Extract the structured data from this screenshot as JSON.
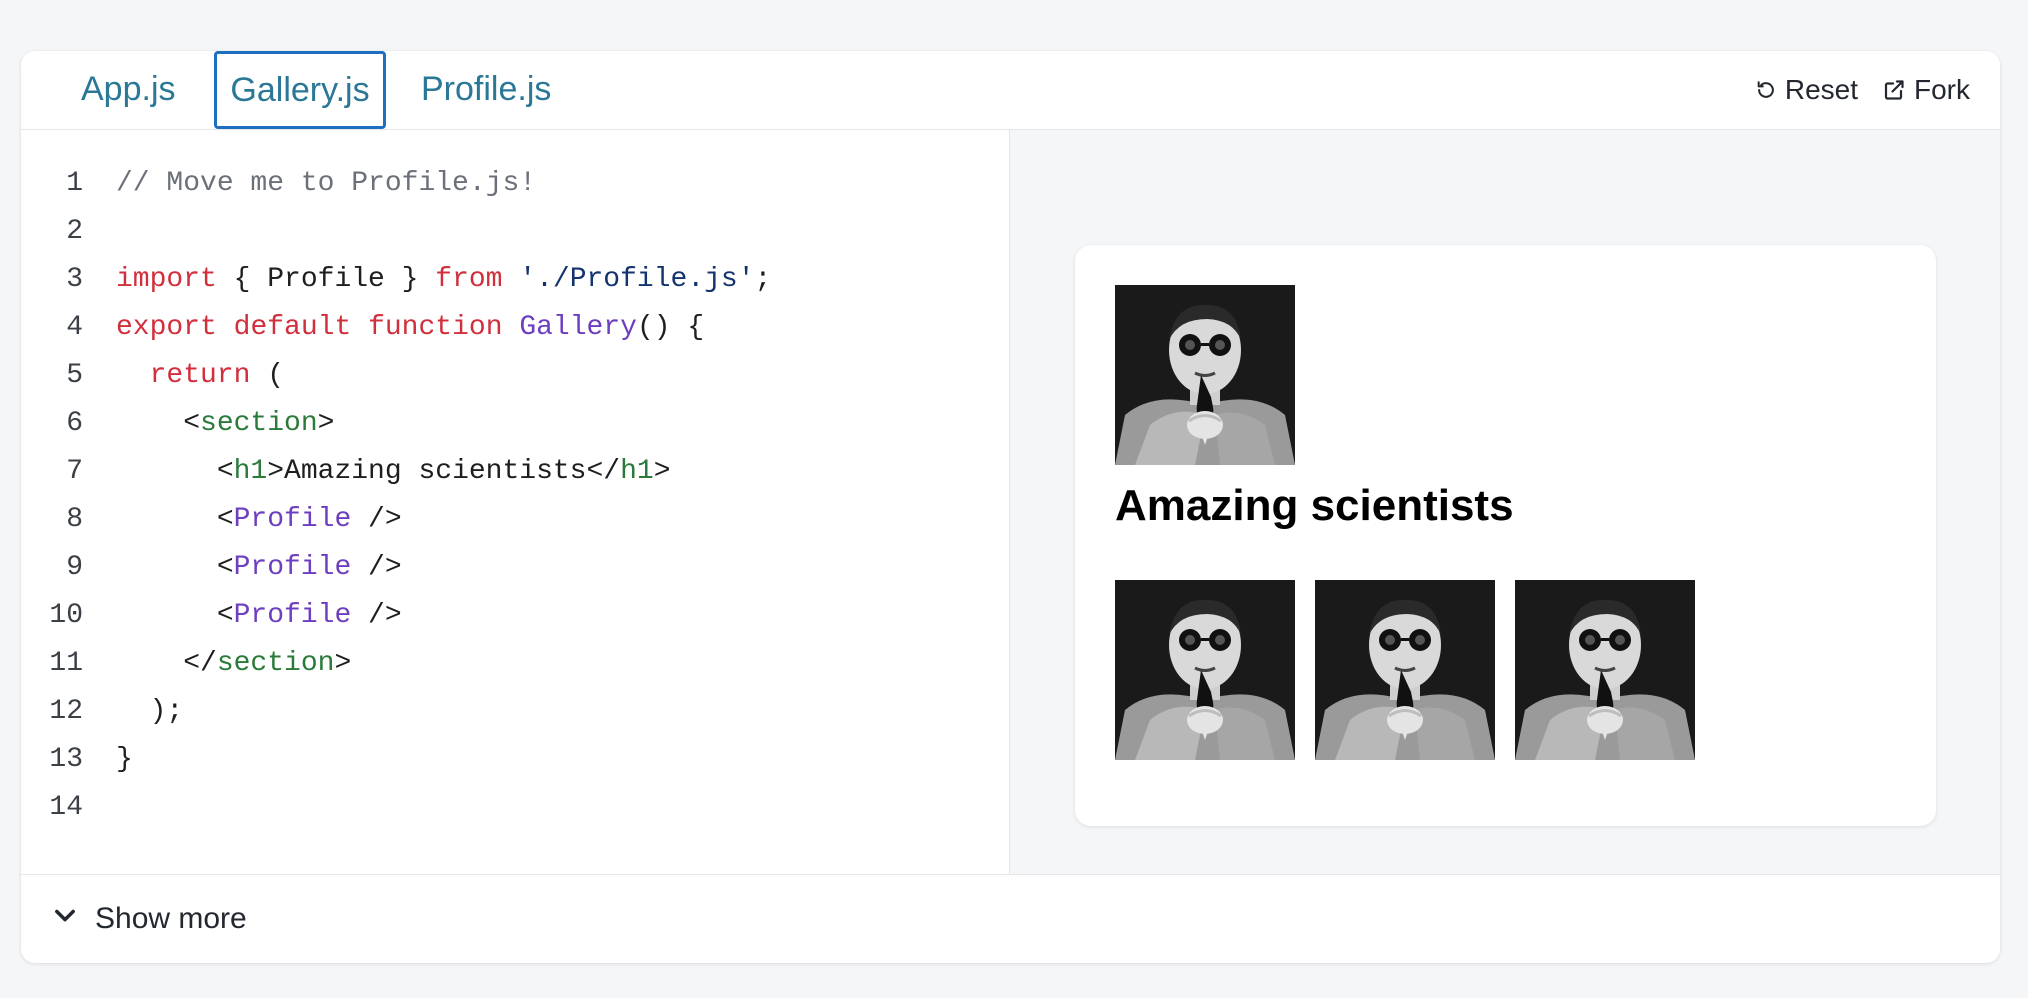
{
  "tabs": [
    {
      "label": "App.js",
      "active": false
    },
    {
      "label": "Gallery.js",
      "active": true
    },
    {
      "label": "Profile.js",
      "active": false
    }
  ],
  "toolbar": {
    "reset_label": "Reset",
    "fork_label": "Fork"
  },
  "editor": {
    "line_numbers": [
      "1",
      "2",
      "3",
      "4",
      "5",
      "6",
      "7",
      "8",
      "9",
      "10",
      "11",
      "12",
      "13",
      "14"
    ],
    "lines": [
      [
        {
          "t": "// Move me to Profile.js!",
          "c": "comment"
        }
      ],
      [],
      [
        {
          "t": "import",
          "c": "kw"
        },
        {
          "t": " { Profile } ",
          "c": ""
        },
        {
          "t": "from",
          "c": "kw"
        },
        {
          "t": " ",
          "c": ""
        },
        {
          "t": "'./Profile.js'",
          "c": "str"
        },
        {
          "t": ";",
          "c": ""
        }
      ],
      [
        {
          "t": "export",
          "c": "kw"
        },
        {
          "t": " ",
          "c": ""
        },
        {
          "t": "default",
          "c": "kw"
        },
        {
          "t": " ",
          "c": ""
        },
        {
          "t": "function",
          "c": "kw"
        },
        {
          "t": " ",
          "c": ""
        },
        {
          "t": "Gallery",
          "c": "fn"
        },
        {
          "t": "() {",
          "c": ""
        }
      ],
      [
        {
          "t": "  ",
          "c": ""
        },
        {
          "t": "return",
          "c": "kw"
        },
        {
          "t": " (",
          "c": ""
        }
      ],
      [
        {
          "t": "    <",
          "c": ""
        },
        {
          "t": "section",
          "c": "tag"
        },
        {
          "t": ">",
          "c": ""
        }
      ],
      [
        {
          "t": "      <",
          "c": ""
        },
        {
          "t": "h1",
          "c": "tag"
        },
        {
          "t": ">Amazing scientists</",
          "c": ""
        },
        {
          "t": "h1",
          "c": "tag"
        },
        {
          "t": ">",
          "c": ""
        }
      ],
      [
        {
          "t": "      <",
          "c": ""
        },
        {
          "t": "Profile",
          "c": "comp"
        },
        {
          "t": " />",
          "c": ""
        }
      ],
      [
        {
          "t": "      <",
          "c": ""
        },
        {
          "t": "Profile",
          "c": "comp"
        },
        {
          "t": " />",
          "c": ""
        }
      ],
      [
        {
          "t": "      <",
          "c": ""
        },
        {
          "t": "Profile",
          "c": "comp"
        },
        {
          "t": " />",
          "c": ""
        }
      ],
      [
        {
          "t": "    </",
          "c": ""
        },
        {
          "t": "section",
          "c": "tag"
        },
        {
          "t": ">",
          "c": ""
        }
      ],
      [
        {
          "t": "  );",
          "c": ""
        }
      ],
      [
        {
          "t": "}",
          "c": ""
        }
      ],
      []
    ]
  },
  "preview": {
    "heading": "Amazing scientists",
    "portrait_count": 4
  },
  "footer": {
    "show_more_label": "Show more"
  },
  "colors": {
    "tab_text": "#2a7896",
    "active_tab_border": "#1f6fc0",
    "keyword": "#d12f3c",
    "string": "#14346e",
    "function": "#6d3fc0",
    "tag": "#2a7a3a",
    "comment": "#6b7079"
  }
}
